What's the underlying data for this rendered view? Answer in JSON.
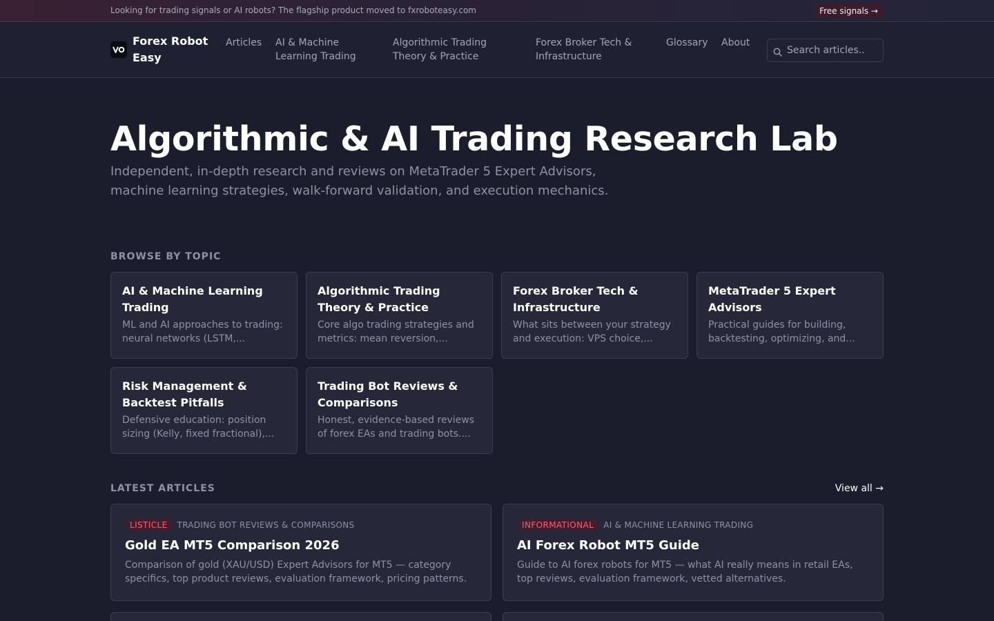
{
  "promo": {
    "text": "Looking for trading signals or AI robots? The flagship product moved to fxroboteasy.com",
    "button": "Free signals →"
  },
  "header": {
    "brand": "Forex Robot Easy",
    "logo_icon": "fre-logo-icon",
    "nav": [
      "Articles",
      "AI & Machine Learning Trading",
      "Algorithmic Trading Theory & Practice",
      "Forex Broker Tech & Infrastructure",
      "Glossary",
      "About"
    ],
    "search_placeholder": "Search articles..",
    "search_icon": "search-icon"
  },
  "hero": {
    "title": "Algorithmic & AI Trading Research Lab",
    "subtitle": "Independent, in-depth research and reviews on MetaTrader 5 Expert Advisors, machine learning strategies, walk-forward validation, and execution mechanics."
  },
  "topics": {
    "label": "BROWSE BY TOPIC",
    "items": [
      {
        "title": "AI & Machine Learning Trading",
        "desc": "ML and AI approaches to trading: neural networks (LSTM,..."
      },
      {
        "title": "Algorithmic Trading Theory & Practice",
        "desc": "Core algo trading strategies and metrics: mean reversion,..."
      },
      {
        "title": "Forex Broker Tech & Infrastructure",
        "desc": "What sits between your strategy and execution: VPS choice,..."
      },
      {
        "title": "MetaTrader 5 Expert Advisors",
        "desc": "Practical guides for building, backtesting, optimizing, and..."
      },
      {
        "title": "Risk Management & Backtest Pitfalls",
        "desc": "Defensive education: position sizing (Kelly, fixed fractional),..."
      },
      {
        "title": "Trading Bot Reviews & Comparisons",
        "desc": "Honest, evidence-based reviews of forex EAs and trading bots...."
      }
    ]
  },
  "latest": {
    "label": "LATEST ARTICLES",
    "view_all": "View all →",
    "articles": [
      {
        "badge": "LISTICLE",
        "category": "TRADING BOT REVIEWS & COMPARISONS",
        "title": "Gold EA MT5 Comparison 2026",
        "desc": "Comparison of gold (XAU/USD) Expert Advisors for MT5 — category specifics, top product reviews, evaluation framework, pricing patterns."
      },
      {
        "badge": "INFORMATIONAL",
        "category": "AI & MACHINE LEARNING TRADING",
        "title": "AI Forex Robot MT5 Guide",
        "desc": "Guide to AI forex robots for MT5 — what AI really means in retail EAs, top reviews, evaluation framework, vetted alternatives."
      }
    ]
  },
  "colors": {
    "background": "#1b1d2c",
    "card": "#262839",
    "badge_text": "#ff5d6c",
    "muted_text": "#8f92a6"
  }
}
